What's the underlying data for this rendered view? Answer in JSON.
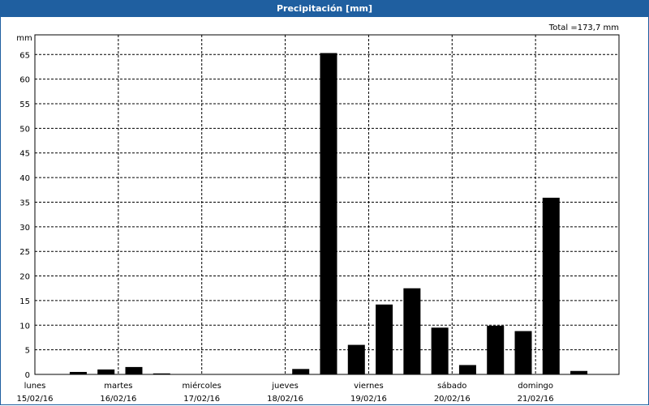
{
  "title": "Precipitación [mm]",
  "total_label": "Total =173,7 mm",
  "colors": {
    "title_bar": "#1f5fa0",
    "bar": "#000000",
    "grid": "#000000"
  },
  "chart_data": {
    "type": "bar",
    "title": "Precipitación [mm]",
    "ylabel": "mm",
    "ylim": [
      0,
      69
    ],
    "yticks": [
      0,
      5,
      10,
      15,
      20,
      25,
      30,
      35,
      40,
      45,
      50,
      55,
      60,
      65
    ],
    "grid": true,
    "day_labels": [
      {
        "day": "lunes",
        "date": "15/02/16"
      },
      {
        "day": "martes",
        "date": "16/02/16"
      },
      {
        "day": "miércoles",
        "date": "17/02/16"
      },
      {
        "day": "jueves",
        "date": "18/02/16"
      },
      {
        "day": "viernes",
        "date": "19/02/16"
      },
      {
        "day": "sábado",
        "date": "20/02/16"
      },
      {
        "day": "domingo",
        "date": "21/02/16"
      }
    ],
    "values": [
      0,
      0.5,
      1.0,
      1.5,
      0.2,
      0,
      0,
      0,
      0,
      1.1,
      65.3,
      6.0,
      14.2,
      17.5,
      9.5,
      1.9,
      9.9,
      8.8,
      35.9,
      0.7
    ],
    "total": "173,7"
  }
}
